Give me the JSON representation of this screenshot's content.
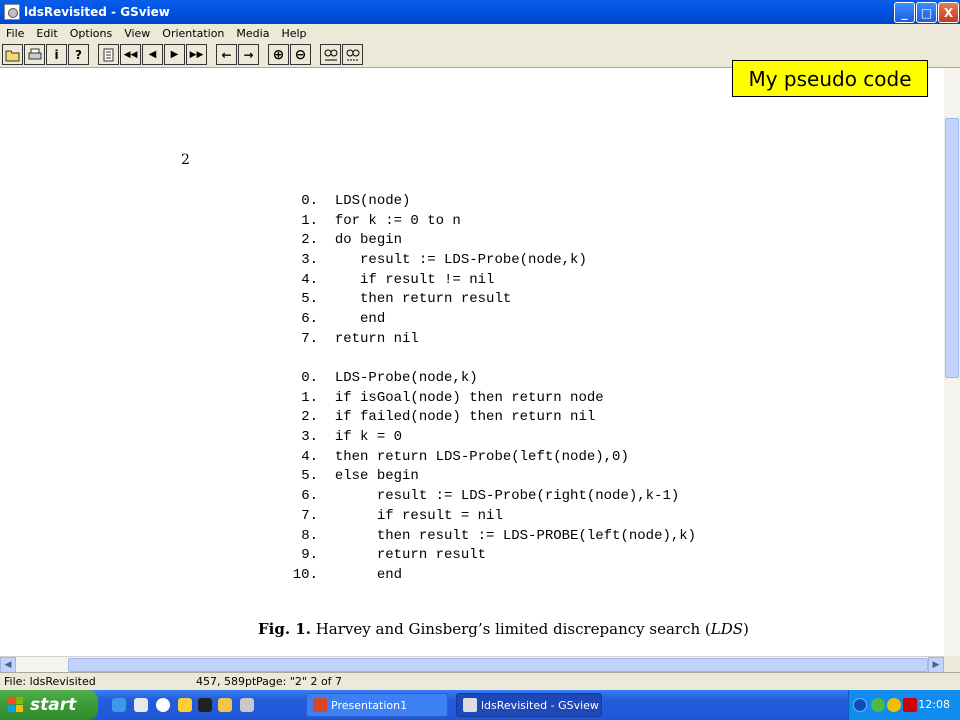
{
  "window": {
    "title": "ldsRevisited - GSview",
    "minimize": "_",
    "maximize": "□",
    "close": "X"
  },
  "menu": [
    "File",
    "Edit",
    "Options",
    "View",
    "Orientation",
    "Media",
    "Help"
  ],
  "toolbar": {
    "buttons": [
      "open-icon",
      "print-icon",
      "info-icon",
      "help-icon",
      "page-icon",
      "first-page-icon",
      "prev-page-icon",
      "next-page-icon",
      "last-page-icon",
      "back-icon",
      "forward-icon",
      "zoom-in-icon",
      "zoom-out-icon",
      "view-abc-icon",
      "view-full-icon"
    ],
    "labels": {
      "info": "i",
      "help": "?",
      "prev": "◀",
      "next": "▶",
      "first": "◀◀",
      "last": "▶▶",
      "back": "←",
      "forward": "→",
      "zoom_in": "⊕",
      "zoom_out": "⊖"
    }
  },
  "document": {
    "page_number": "2",
    "lds_code": [
      {
        "num": "0.",
        "text": "LDS(node)"
      },
      {
        "num": "1.",
        "text": "for k := 0 to n"
      },
      {
        "num": "2.",
        "text": "do begin"
      },
      {
        "num": "3.",
        "text": "   result := LDS-Probe(node,k)"
      },
      {
        "num": "4.",
        "text": "   if result != nil"
      },
      {
        "num": "5.",
        "text": "   then return result"
      },
      {
        "num": "6.",
        "text": "   end"
      },
      {
        "num": "7.",
        "text": "return nil"
      }
    ],
    "probe_code": [
      {
        "num": "0.",
        "text": "LDS-Probe(node,k)"
      },
      {
        "num": "1.",
        "text": "if isGoal(node) then return node"
      },
      {
        "num": "2.",
        "text": "if failed(node) then return nil"
      },
      {
        "num": "3.",
        "text": "if k = 0"
      },
      {
        "num": "4.",
        "text": "then return LDS-Probe(left(node),0)"
      },
      {
        "num": "5.",
        "text": "else begin"
      },
      {
        "num": "6.",
        "text": "     result := LDS-Probe(right(node),k-1)"
      },
      {
        "num": "7.",
        "text": "     if result = nil"
      },
      {
        "num": "8.",
        "text": "     then result := LDS-PROBE(left(node),k)"
      },
      {
        "num": "9.",
        "text": "     return result"
      },
      {
        "num": "10.",
        "text": "     end"
      }
    ],
    "caption": {
      "label": "Fig. 1.",
      "text": " Harvey and Ginsberg’s limited discrepancy search (",
      "abbr": "LDS",
      "close": ")"
    }
  },
  "annotation": "My pseudo code",
  "status": {
    "file": "File: ldsRevisited",
    "coords": "457, 589pt",
    "page": "Page: \"2\"  2 of 7"
  },
  "taskbar": {
    "start": "start",
    "tasks": [
      {
        "label": "Presentation1",
        "active": false
      },
      {
        "label": "ldsRevisited - GSview",
        "active": true
      }
    ],
    "clock": "12:08"
  }
}
